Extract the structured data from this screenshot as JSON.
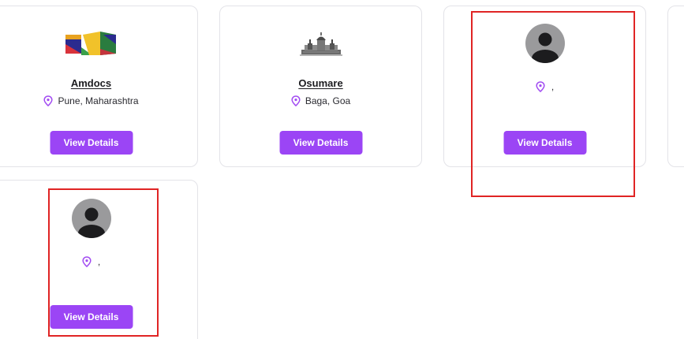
{
  "cards": [
    {
      "company": "Amdocs",
      "location": "Pune, Maharashtra",
      "button_label": "View Details",
      "logo_icon": "amdocs-logo-icon"
    },
    {
      "company": "Osumare",
      "location": "Baga, Goa",
      "button_label": "View Details",
      "logo_icon": "osumare-building-logo-icon"
    },
    {
      "company": "",
      "location": ",",
      "button_label": "View Details",
      "logo_icon": "default-avatar-icon"
    },
    {
      "company": "",
      "location": ",",
      "button_label": "View Details",
      "logo_icon": "default-avatar-icon"
    }
  ],
  "colors": {
    "accent": "#9b45f5",
    "pin": "#a24cf2",
    "highlight": "#e02424",
    "avatar_bg": "#9a9a9c",
    "avatar_fg": "#1c1c1e"
  }
}
